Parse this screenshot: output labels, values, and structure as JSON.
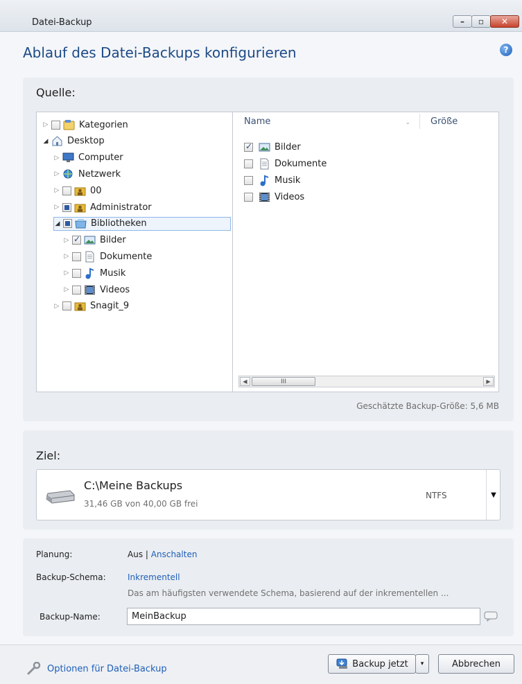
{
  "window": {
    "title": "Datei-Backup"
  },
  "header": {
    "heading": "Ablauf des Datei-Backups konfigurieren",
    "help_glyph": "?"
  },
  "source": {
    "label": "Quelle:",
    "tree": [
      {
        "label": "Kategorien",
        "icon": "categories-icon",
        "state": "unchecked",
        "expanded": false
      },
      {
        "label": "Desktop",
        "icon": "desktop-home-icon",
        "state": "none",
        "expanded": true
      },
      {
        "label": "Computer",
        "icon": "computer-icon",
        "state": "none",
        "expanded": false
      },
      {
        "label": "Netzwerk",
        "icon": "network-icon",
        "state": "none",
        "expanded": false
      },
      {
        "label": "00",
        "icon": "user-folder-icon",
        "state": "unchecked",
        "expanded": false
      },
      {
        "label": "Administrator",
        "icon": "user-folder-icon",
        "state": "partial",
        "expanded": false
      },
      {
        "label": "Bibliotheken",
        "icon": "library-icon",
        "state": "partial",
        "expanded": true
      },
      {
        "label": "Bilder",
        "icon": "pictures-icon",
        "state": "checked",
        "expanded": false
      },
      {
        "label": "Dokumente",
        "icon": "documents-icon",
        "state": "unchecked",
        "expanded": false
      },
      {
        "label": "Musik",
        "icon": "music-icon",
        "state": "unchecked",
        "expanded": false
      },
      {
        "label": "Videos",
        "icon": "videos-icon",
        "state": "unchecked",
        "expanded": false
      },
      {
        "label": "Snagit_9",
        "icon": "user-folder-icon",
        "state": "unchecked",
        "expanded": false
      }
    ],
    "columns": {
      "name": "Name",
      "size": "Größe"
    },
    "files": [
      {
        "label": "Bilder",
        "icon": "pictures-icon",
        "state": "checked"
      },
      {
        "label": "Dokumente",
        "icon": "documents-icon",
        "state": "unchecked"
      },
      {
        "label": "Musik",
        "icon": "music-icon",
        "state": "unchecked"
      },
      {
        "label": "Videos",
        "icon": "videos-icon",
        "state": "unchecked"
      }
    ],
    "scroll_grip": "III",
    "estimated_size": "Geschätzte Backup-Größe: 5,6 MB"
  },
  "target": {
    "label": "Ziel:",
    "path": "C:\\Meine Backups",
    "free": "31,46 GB von 40,00 GB frei",
    "filesystem": "NTFS",
    "dropdown_glyph": "▼"
  },
  "settings": {
    "schedule_label": "Planung:",
    "schedule_value": "Aus",
    "schedule_sep": "|",
    "schedule_link": "Anschalten",
    "scheme_label": "Backup-Schema:",
    "scheme_link": "Inkrementell",
    "scheme_desc": "Das am häufigsten verwendete Schema, basierend auf der inkrementellen ...",
    "name_label": "Backup-Name:",
    "name_value": "MeinBackup"
  },
  "footer": {
    "options_link": "Optionen für Datei-Backup",
    "backup_now": "Backup jetzt",
    "cancel": "Abbrechen"
  }
}
